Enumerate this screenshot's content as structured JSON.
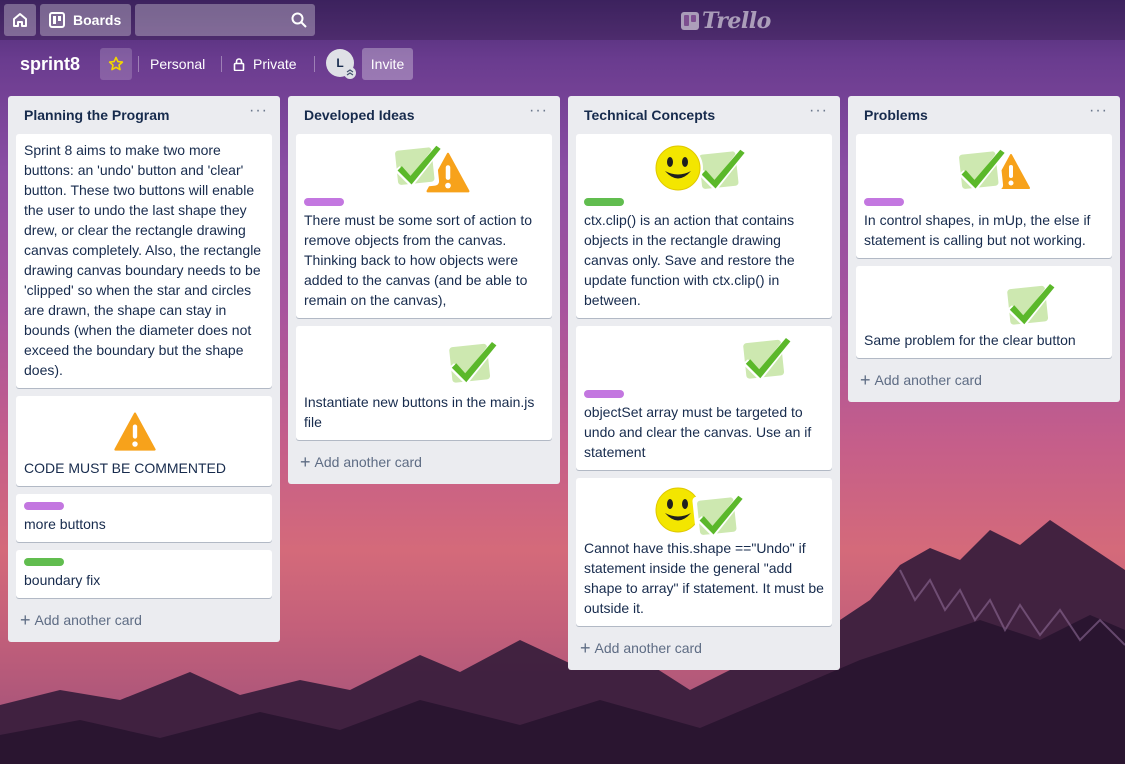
{
  "topbar": {
    "boards_label": "Boards",
    "logo_text": "Trello"
  },
  "board": {
    "name": "sprint8",
    "personal_label": "Personal",
    "private_label": "Private",
    "avatar_initial": "L",
    "invite_label": "Invite"
  },
  "colors": {
    "label_green": "#61bd4f",
    "label_purple": "#c377e0"
  },
  "lists": [
    {
      "title": "Planning the Program",
      "menu": "···",
      "add_card": "Add another card",
      "cards": [
        {
          "text": "Sprint 8 aims to make two more buttons: an 'undo' button and 'clear' button. These two buttons will enable the user to undo the last shape they drew, or clear the rectangle drawing canvas completely. Also, the rectangle drawing canvas boundary needs to be 'clipped' so when the star and circles are drawn, the shape can stay in bounds (when the diameter does not exceed the boundary but the shape does)."
        },
        {
          "text": "CODE MUST BE COMMENTED",
          "stickers": [
            "warning-sticker"
          ]
        },
        {
          "text": "more buttons",
          "label": "purple"
        },
        {
          "text": "boundary fix",
          "label": "green"
        }
      ]
    },
    {
      "title": "Developed Ideas",
      "menu": "···",
      "add_card": "Add another card",
      "cards": [
        {
          "text": "There must be some sort of action to remove objects from the canvas. Thinking back to how objects were added to the canvas (and be able to remain on the canvas),",
          "label": "purple",
          "stickers": [
            "check-sticker",
            "warning-sticker"
          ]
        },
        {
          "text": "Instantiate new buttons in the main.js file",
          "stickers": [
            "check-sticker"
          ]
        }
      ]
    },
    {
      "title": "Technical Concepts",
      "menu": "···",
      "add_card": "Add another card",
      "cards": [
        {
          "text": "ctx.clip() is an action that contains objects in the rectangle drawing canvas only. Save and restore the update function with ctx.clip() in between.",
          "label": "green",
          "stickers": [
            "smile-sticker",
            "check-sticker"
          ]
        },
        {
          "text": "objectSet array must be targeted to undo and clear the canvas. Use an if statement",
          "label": "purple",
          "stickers": [
            "check-sticker"
          ]
        },
        {
          "text": "Cannot have this.shape ==\"Undo\" if statement inside the general \"add shape to array\" if statement. It must be outside it.",
          "stickers": [
            "smile-sticker",
            "check-sticker"
          ]
        }
      ]
    },
    {
      "title": "Problems",
      "menu": "···",
      "add_card": "Add another card",
      "cards": [
        {
          "text": "In control shapes, in mUp, the else if statement is calling but not working.",
          "label": "purple",
          "stickers": [
            "check-sticker",
            "warning-sticker"
          ]
        },
        {
          "text": "Same problem for the clear button",
          "stickers": [
            "check-sticker"
          ]
        }
      ]
    }
  ]
}
